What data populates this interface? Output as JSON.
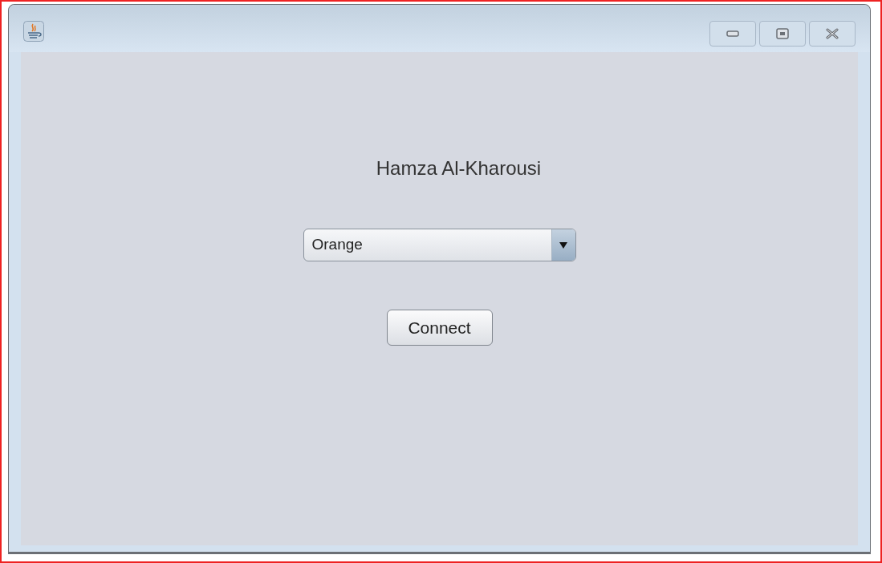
{
  "heading": "Hamza Al-Kharousi",
  "combo_box": {
    "value": "Orange"
  },
  "button": {
    "label": "Connect"
  }
}
